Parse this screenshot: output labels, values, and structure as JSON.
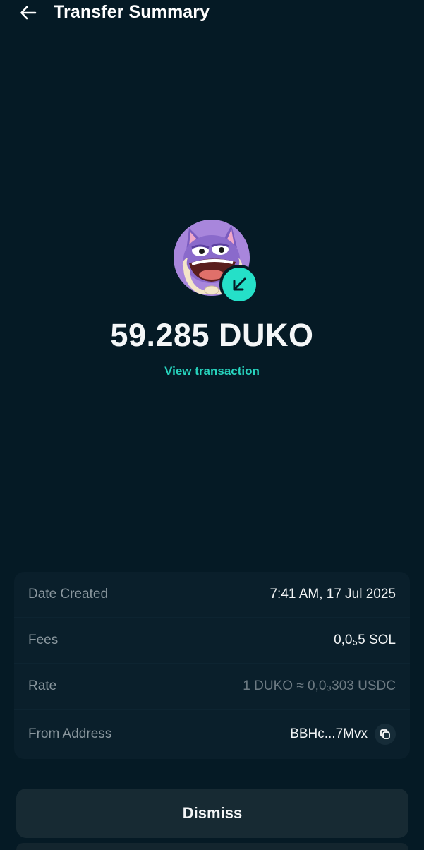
{
  "header": {
    "title": "Transfer Summary",
    "back_icon": "arrow-left-icon"
  },
  "token": {
    "avatar_icon": "duko-token-avatar",
    "badge_icon": "arrow-down-left-icon",
    "amount": "59.285 DUKO",
    "view_transaction_label": "View transaction"
  },
  "details": {
    "date_created": {
      "label": "Date Created",
      "value": "7:41 AM, 17 Jul 2025"
    },
    "fees": {
      "label": "Fees",
      "value": "0,0₅5 SOL"
    },
    "rate": {
      "label": "Rate",
      "value": "1 DUKO ≈ 0,0₃303 USDC"
    },
    "from_address": {
      "label": "From Address",
      "value": "BBHc...7Mvx",
      "copy_icon": "copy-icon"
    }
  },
  "actions": {
    "dismiss_label": "Dismiss"
  },
  "colors": {
    "background": "#051a25",
    "accent": "#25e0c8",
    "card": "#0a1f2b",
    "button": "#172a33"
  }
}
